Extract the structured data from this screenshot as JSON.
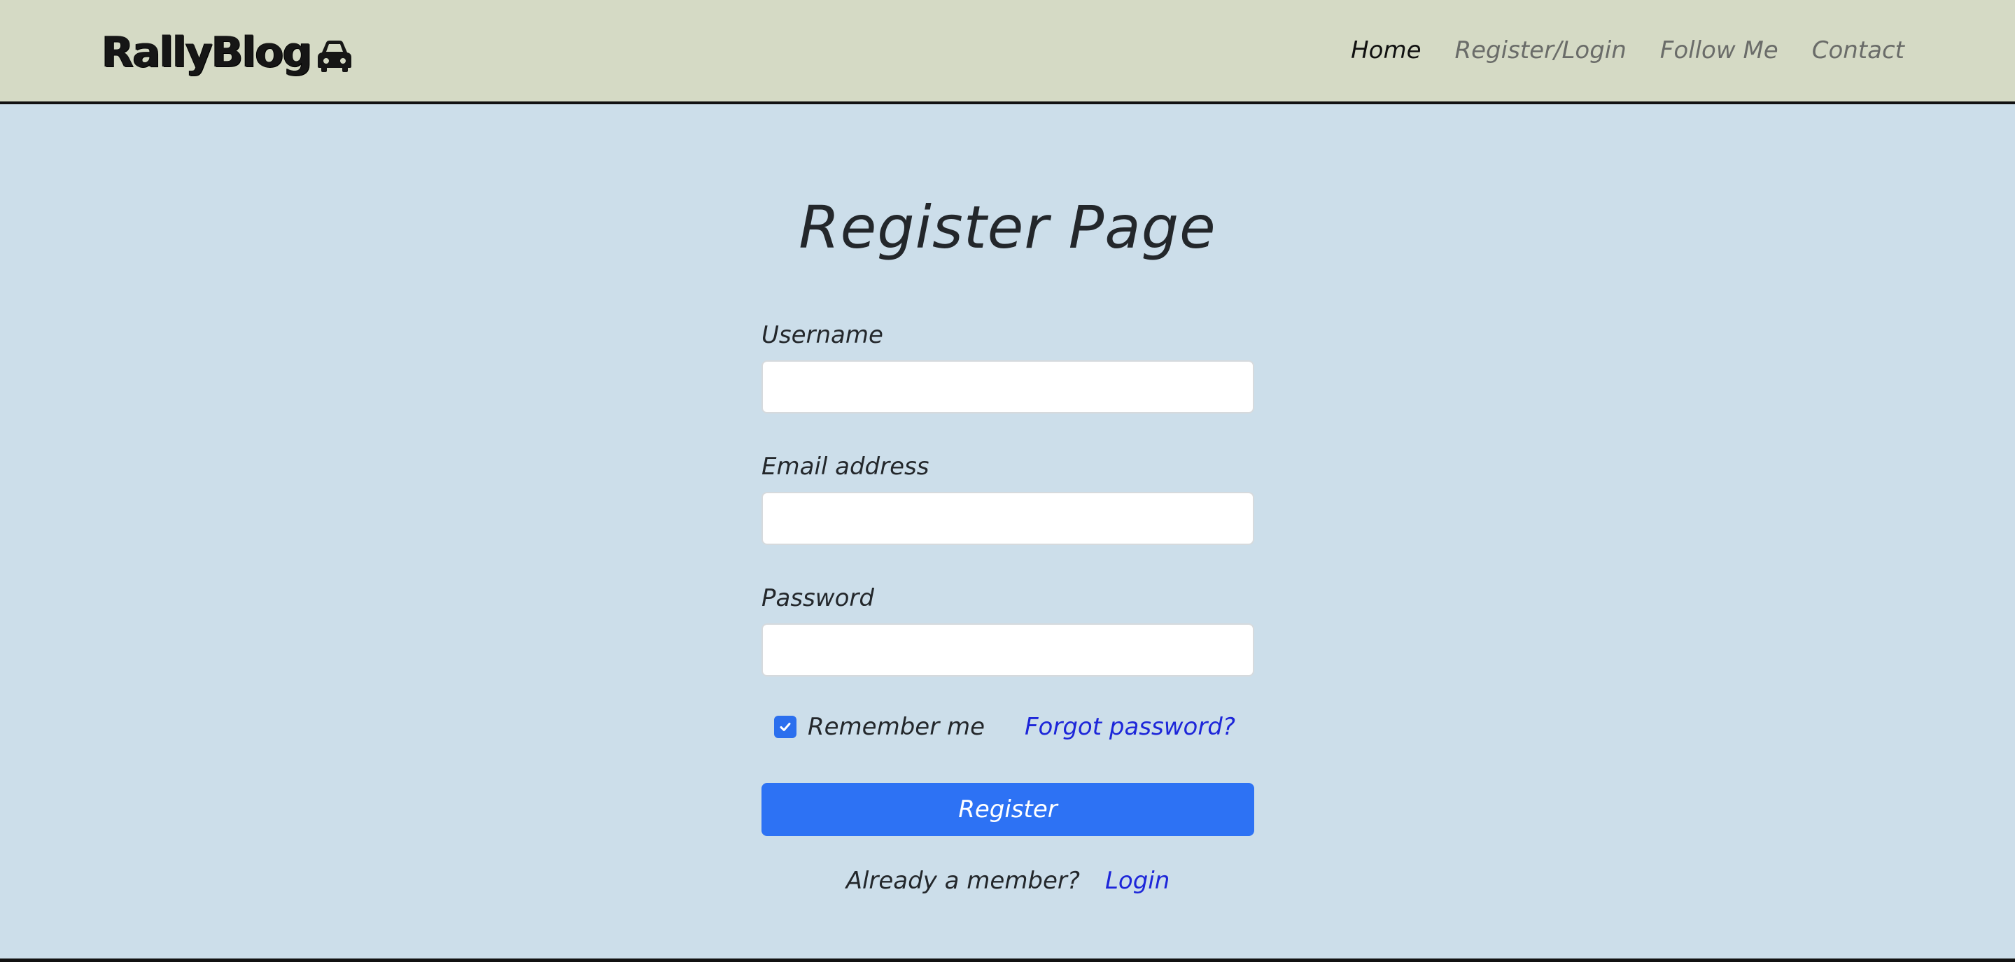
{
  "navbar": {
    "brand": "RallyBlog",
    "brand_icon": "car-icon",
    "links": [
      {
        "label": "Home",
        "active": true
      },
      {
        "label": "Register/Login",
        "active": false
      },
      {
        "label": "Follow Me",
        "active": false
      },
      {
        "label": "Contact",
        "active": false
      }
    ]
  },
  "page": {
    "title": "Register Page"
  },
  "form": {
    "username_label": "Username",
    "username_value": "",
    "email_label": "Email address",
    "email_value": "",
    "password_label": "Password",
    "password_value": "",
    "remember_label": "Remember me",
    "remember_checked": true,
    "forgot_label": "Forgot password?",
    "submit_label": "Register",
    "member_text": "Already a member?",
    "login_label": "Login"
  },
  "colors": {
    "navbar_bg": "#d5dac5",
    "page_bg": "#ccdeea",
    "primary": "#2d72f4",
    "link": "#1d26d9"
  }
}
